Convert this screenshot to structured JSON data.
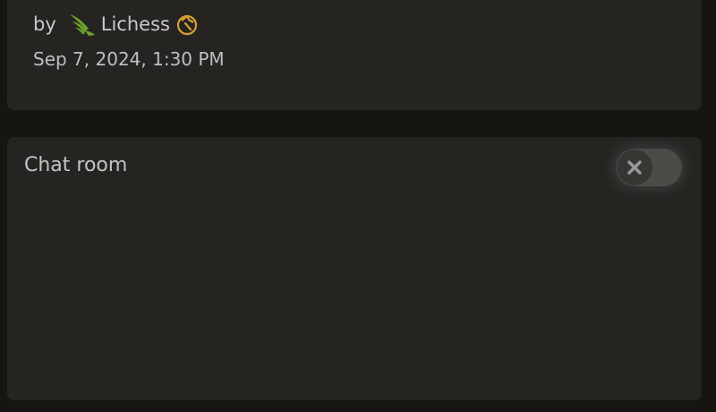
{
  "post": {
    "by_label": "by",
    "author": "Lichess",
    "author_icon": "lichess-wing-icon",
    "patron_icon": "patron-horse-icon",
    "datetime": "Sep 7, 2024, 1:30 PM"
  },
  "chat": {
    "title": "Chat room",
    "toggle_state": "off",
    "toggle_icon": "close-icon"
  },
  "colors": {
    "background": "#161512",
    "card": "#262421",
    "author_icon": "#6ba12a",
    "patron_icon": "#d6a033"
  }
}
